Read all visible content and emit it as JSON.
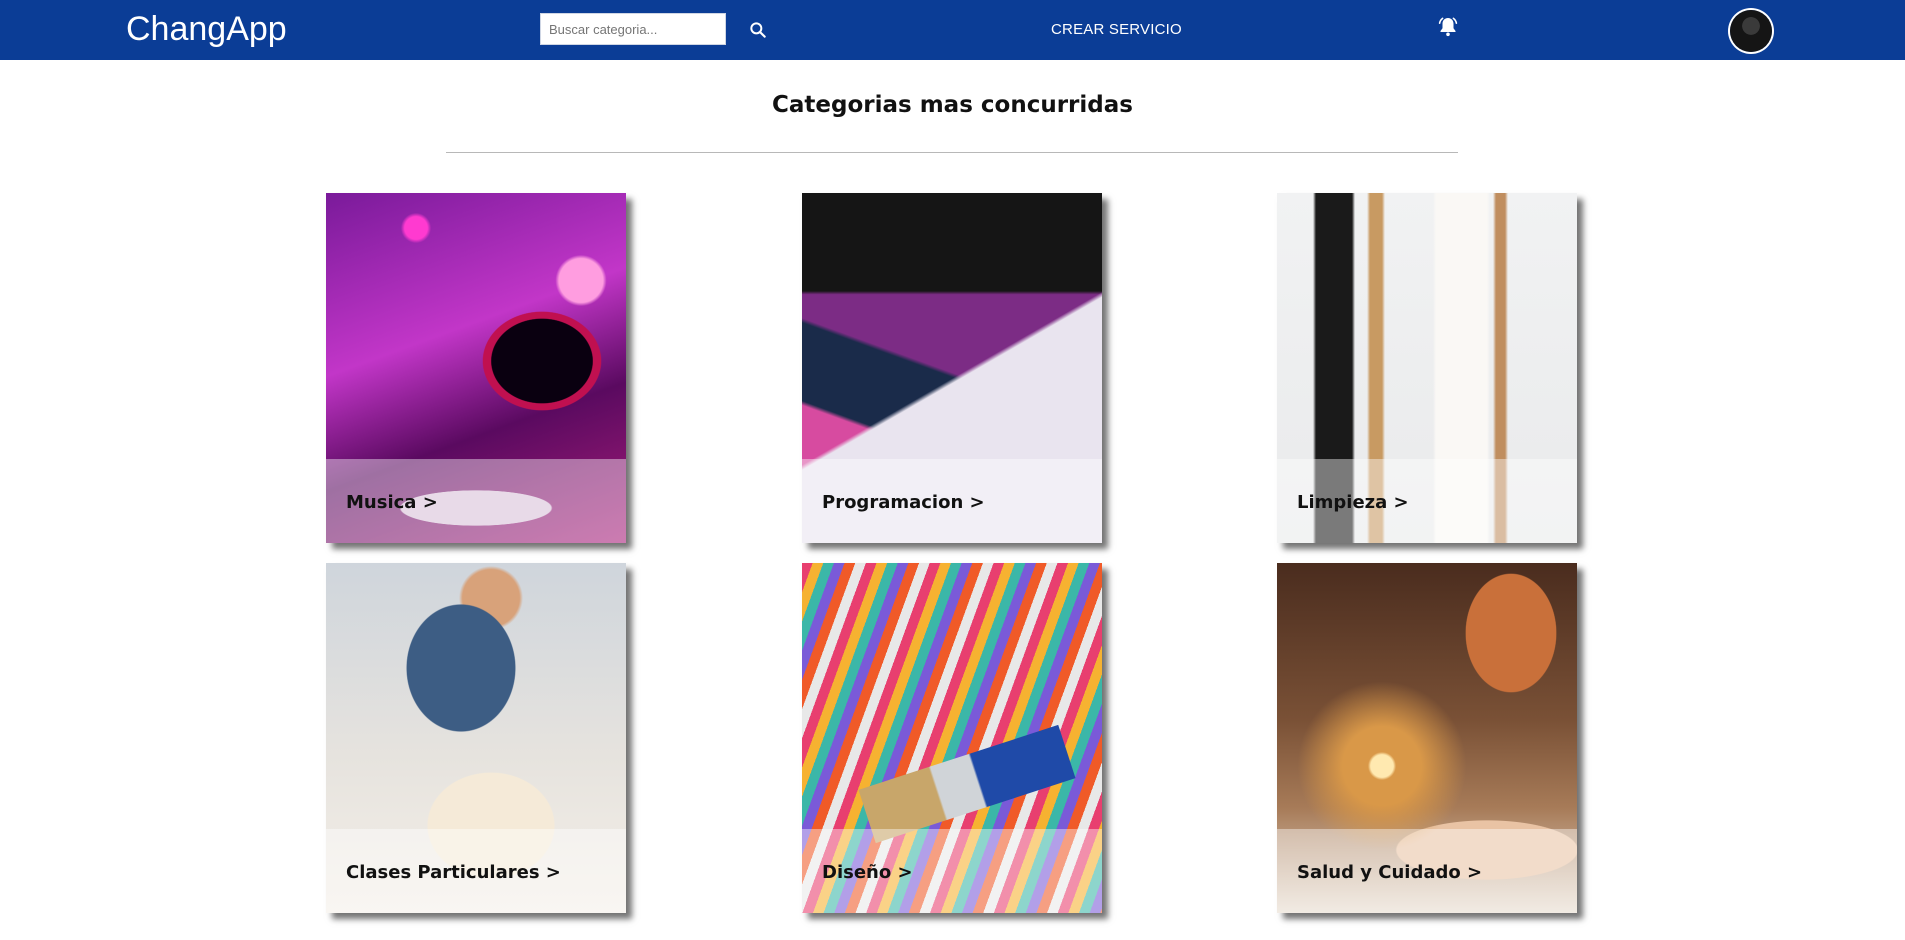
{
  "navbar": {
    "brand": "ChangApp",
    "search_placeholder": "Buscar categoria...",
    "create_service": "CREAR SERVICIO"
  },
  "page": {
    "title": "Categorias mas concurridas"
  },
  "categories": [
    {
      "label": "Musica >"
    },
    {
      "label": "Programacion >"
    },
    {
      "label": "Limpieza >"
    },
    {
      "label": "Clases Particulares >"
    },
    {
      "label": "Diseño >"
    },
    {
      "label": "Salud y Cuidado >"
    }
  ],
  "colors": {
    "navbar": "#0b3d96",
    "text": "#111111",
    "divider": "#b8b8b8"
  },
  "icons": [
    "search-icon",
    "bell-icon",
    "avatar"
  ]
}
